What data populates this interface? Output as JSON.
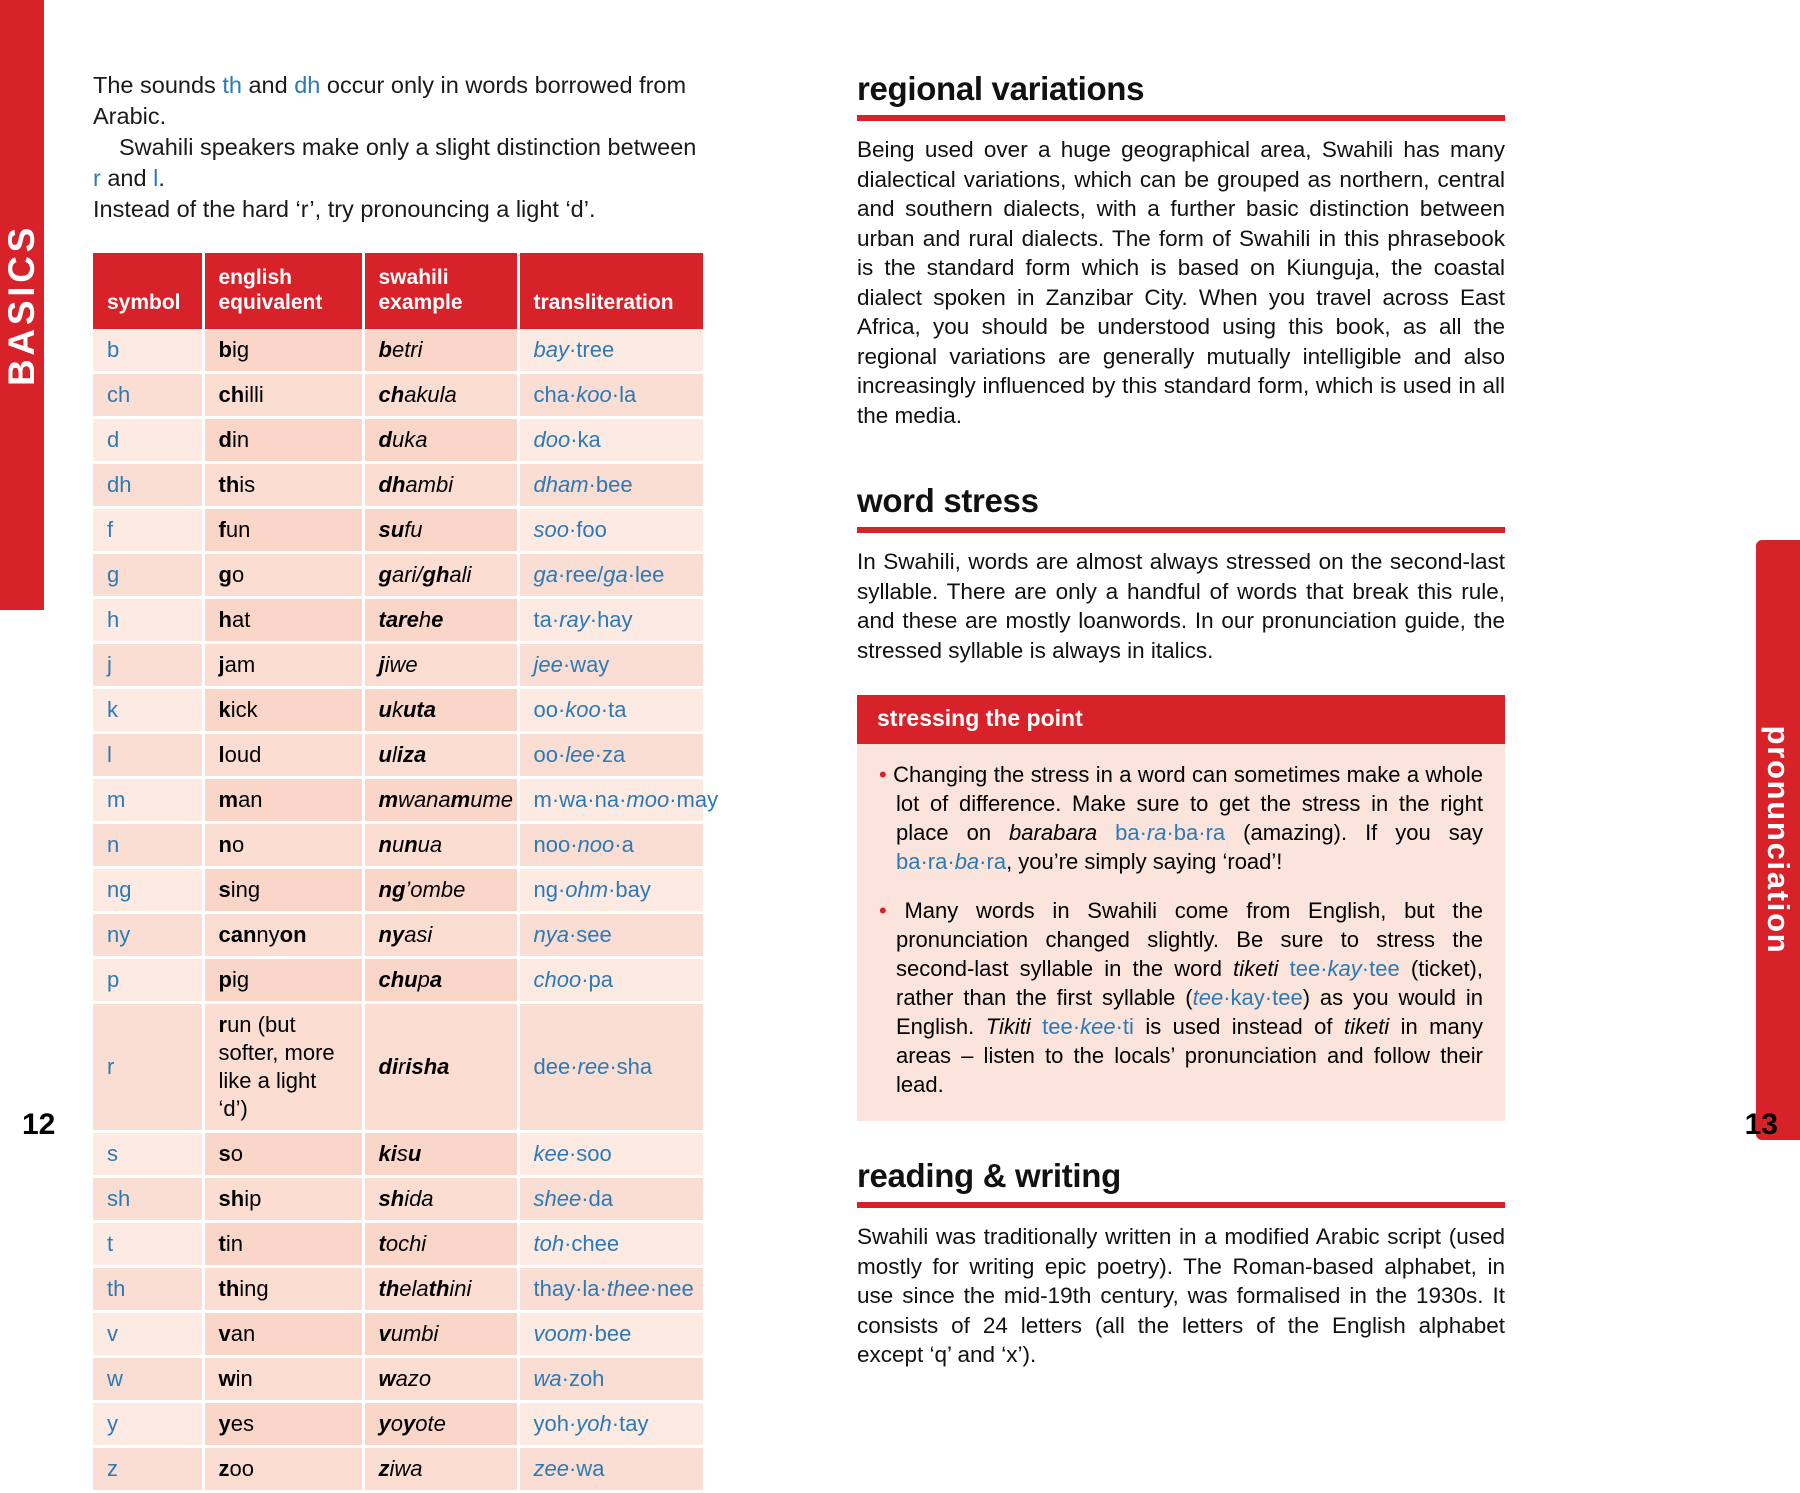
{
  "tabs": {
    "left_label": "BASICS",
    "right_label": "pronunciation"
  },
  "folios": {
    "left": "12",
    "right": "13"
  },
  "left_page": {
    "intro": {
      "line1_a": "The sounds ",
      "line1_b": "th",
      "line1_c": " and ",
      "line1_d": "dh",
      "line1_e": " occur only in words borrowed from Arabic.",
      "line2_a": "Swahili speakers make only a slight distinction between ",
      "line2_b": "r",
      "line2_c": " and ",
      "line2_d": "l",
      "line2_e": ".",
      "line3": "Instead of the hard ‘r’, try pronouncing a light ‘d’."
    },
    "table": {
      "headers": [
        "symbol",
        "english equivalent",
        "swahili example",
        "transliteration"
      ],
      "rows": [
        {
          "symbol": "b",
          "english": [
            "b",
            "ig"
          ],
          "swahili": [
            "b",
            "etri"
          ],
          "translit": "bay·tree",
          "tr_parts": [
            [
              "i",
              "bay"
            ],
            [
              "p",
              "·tree"
            ]
          ]
        },
        {
          "symbol": "ch",
          "english": [
            "ch",
            "illi"
          ],
          "swahili": [
            "ch",
            "akula"
          ],
          "translit": "cha·koo·la",
          "tr_parts": [
            [
              "p",
              "cha·"
            ],
            [
              "i",
              "koo"
            ],
            [
              "p",
              "·la"
            ]
          ]
        },
        {
          "symbol": "d",
          "english": [
            "d",
            "in"
          ],
          "swahili": [
            "d",
            "uka"
          ],
          "translit": "doo·ka",
          "tr_parts": [
            [
              "i",
              "doo"
            ],
            [
              "p",
              "·ka"
            ]
          ]
        },
        {
          "symbol": "dh",
          "english": [
            "th",
            "is"
          ],
          "swahili": [
            "dh",
            "ambi"
          ],
          "translit": "dham·bee",
          "tr_parts": [
            [
              "i",
              "dham"
            ],
            [
              "p",
              "·bee"
            ]
          ]
        },
        {
          "symbol": "f",
          "english": [
            "f",
            "un"
          ],
          "swahili": [
            "su",
            "fu"
          ],
          "translit": "soo·foo",
          "tr_parts": [
            [
              "i",
              "soo"
            ],
            [
              "p",
              "·foo"
            ]
          ]
        },
        {
          "symbol": "g",
          "english": [
            "g",
            "o"
          ],
          "swahili": [
            "g",
            "ari/",
            "gh",
            "ali"
          ],
          "translit": "ga·ree/ga·lee",
          "tr_parts": [
            [
              "i",
              "ga"
            ],
            [
              "p",
              "·ree/"
            ],
            [
              "i",
              "ga"
            ],
            [
              "p",
              "·lee"
            ]
          ]
        },
        {
          "symbol": "h",
          "english": [
            "h",
            "at"
          ],
          "swahili": [
            "tare",
            "h",
            "e"
          ],
          "translit": "ta·ray·hay",
          "tr_parts": [
            [
              "p",
              "ta·"
            ],
            [
              "i",
              "ray"
            ],
            [
              "p",
              "·hay"
            ]
          ]
        },
        {
          "symbol": "j",
          "english": [
            "j",
            "am"
          ],
          "swahili": [
            "j",
            "iwe"
          ],
          "translit": "jee·way",
          "tr_parts": [
            [
              "i",
              "jee"
            ],
            [
              "p",
              "·way"
            ]
          ]
        },
        {
          "symbol": "k",
          "english": [
            "k",
            "ick"
          ],
          "swahili": [
            "u",
            "k",
            "uta"
          ],
          "translit": "oo·koo·ta",
          "tr_parts": [
            [
              "p",
              "oo·"
            ],
            [
              "i",
              "koo"
            ],
            [
              "p",
              "·ta"
            ]
          ]
        },
        {
          "symbol": "l",
          "english": [
            "l",
            "oud"
          ],
          "swahili": [
            "u",
            "l",
            "iza"
          ],
          "translit": "oo·lee·za",
          "tr_parts": [
            [
              "p",
              "oo·"
            ],
            [
              "i",
              "lee"
            ],
            [
              "p",
              "·za"
            ]
          ]
        },
        {
          "symbol": "m",
          "english": [
            "m",
            "an"
          ],
          "swahili": [
            "m",
            "wana",
            "m",
            "ume"
          ],
          "translit": "m·wa·na·moo·may",
          "tr_parts": [
            [
              "p",
              "m·wa·na·"
            ],
            [
              "i",
              "moo"
            ],
            [
              "p",
              "·may"
            ]
          ]
        },
        {
          "symbol": "n",
          "english": [
            "n",
            "o"
          ],
          "swahili": [
            "n",
            "u",
            "n",
            "ua"
          ],
          "translit": "noo·noo·a",
          "tr_parts": [
            [
              "p",
              "noo·"
            ],
            [
              "i",
              "noo"
            ],
            [
              "p",
              "·a"
            ]
          ]
        },
        {
          "symbol": "ng",
          "english": [
            "s",
            "ing",
            ""
          ],
          "swahili": [
            "ng",
            "’ombe"
          ],
          "translit": "ng·ohm·bay",
          "tr_parts": [
            [
              "p",
              "ng·"
            ],
            [
              "i",
              "ohm"
            ],
            [
              "p",
              "·bay"
            ]
          ]
        },
        {
          "symbol": "ny",
          "english": [
            "can",
            "ny",
            "on"
          ],
          "swahili": [
            "ny",
            "asi"
          ],
          "translit": "nya·see",
          "tr_parts": [
            [
              "i",
              "nya"
            ],
            [
              "p",
              "·see"
            ]
          ]
        },
        {
          "symbol": "p",
          "english": [
            "p",
            "ig"
          ],
          "swahili": [
            "chu",
            "p",
            "a"
          ],
          "translit": "choo·pa",
          "tr_parts": [
            [
              "i",
              "choo"
            ],
            [
              "p",
              "·pa"
            ]
          ]
        },
        {
          "symbol": "r",
          "english": [
            "r",
            "un (but softer, more like a light ‘d’)"
          ],
          "swahili": [
            "di",
            "r",
            "isha"
          ],
          "translit": "dee·ree·sha",
          "tr_parts": [
            [
              "p",
              "dee·"
            ],
            [
              "i",
              "ree"
            ],
            [
              "p",
              "·sha"
            ]
          ],
          "tall": true
        },
        {
          "symbol": "s",
          "english": [
            "s",
            "o"
          ],
          "swahili": [
            "ki",
            "s",
            "u"
          ],
          "translit": "kee·soo",
          "tr_parts": [
            [
              "i",
              "kee"
            ],
            [
              "p",
              "·soo"
            ]
          ]
        },
        {
          "symbol": "sh",
          "english": [
            "sh",
            "ip"
          ],
          "swahili": [
            "sh",
            "ida"
          ],
          "translit": "shee·da",
          "tr_parts": [
            [
              "i",
              "shee"
            ],
            [
              "p",
              "·da"
            ]
          ]
        },
        {
          "symbol": "t",
          "english": [
            "t",
            "in"
          ],
          "swahili": [
            "t",
            "ochi"
          ],
          "translit": "toh·chee",
          "tr_parts": [
            [
              "i",
              "toh"
            ],
            [
              "p",
              "·chee"
            ]
          ]
        },
        {
          "symbol": "th",
          "english": [
            "th",
            "ing"
          ],
          "swahili": [
            "th",
            "ela",
            "th",
            "ini"
          ],
          "translit": "thay·la·thee·nee",
          "tr_parts": [
            [
              "p",
              "thay·la·"
            ],
            [
              "i",
              "thee"
            ],
            [
              "p",
              "·nee"
            ]
          ]
        },
        {
          "symbol": "v",
          "english": [
            "v",
            "an"
          ],
          "swahili": [
            "v",
            "umbi"
          ],
          "translit": "voom·bee",
          "tr_parts": [
            [
              "i",
              "voom"
            ],
            [
              "p",
              "·bee"
            ]
          ]
        },
        {
          "symbol": "w",
          "english": [
            "w",
            "in"
          ],
          "swahili": [
            "w",
            "azo"
          ],
          "translit": "wa·zoh",
          "tr_parts": [
            [
              "i",
              "wa"
            ],
            [
              "p",
              "·zoh"
            ]
          ]
        },
        {
          "symbol": "y",
          "english": [
            "y",
            "es"
          ],
          "swahili": [
            "y",
            "o",
            "y",
            "ote"
          ],
          "translit": "yoh·yoh·tay",
          "tr_parts": [
            [
              "p",
              "yoh·"
            ],
            [
              "i",
              "yoh"
            ],
            [
              "p",
              "·tay"
            ]
          ]
        },
        {
          "symbol": "z",
          "english": [
            "z",
            "oo"
          ],
          "swahili": [
            "z",
            "iwa"
          ],
          "translit": "zee·wa",
          "tr_parts": [
            [
              "i",
              "zee"
            ],
            [
              "p",
              "·wa"
            ]
          ]
        }
      ]
    }
  },
  "right_page": {
    "sections": [
      {
        "title": "regional variations",
        "body": "Being used over a huge geographical area, Swahili has many dialectical variations, which can be grouped as northern, central and southern dialects, with a further basic distinction between urban and rural dialects. The form of Swahili in this phrasebook is the standard form which is based on Kiunguja, the coastal dialect spoken in Zanzibar City. When you travel across East Africa, you should be understood using this book, as all the regional variations are generally mutually intelligible and also increasingly influenced by this standard form, which is used in all the media."
      },
      {
        "title": "word stress",
        "body": "In Swahili, words are almost always stressed on the second-last syllable. There are only a handful of words that break this rule, and these are mostly loanwords. In our pronunciation guide, the stressed syllable is always in italics."
      },
      {
        "title": "reading & writing",
        "body": "Swahili was traditionally written in a modified Arabic script (used mostly for writing epic poetry). The Roman-based alphabet, in use since the mid-19th century, was formalised in the 1930s. It consists of 24 letters (all the letters of the English alphabet except ‘q’ and ‘x’)."
      }
    ],
    "tipbox": {
      "title": "stressing the point",
      "bullets": [
        {
          "t1": "Changing the stress in a word can sometimes make a whole lot of difference. Make sure to get the stress in the right place on ",
          "w1_it": "barabara",
          "t2": " ",
          "b1_p1": "ba·",
          "b1_i1": "ra",
          "b1_p2": "·ba·ra",
          "t3": " (amazing). If you say ",
          "b2_p1": "ba·ra·",
          "b2_i1": "ba",
          "b2_p2": "·ra",
          "t4": ", you’re simply saying ‘road’!"
        },
        {
          "t1": "Many words in Swahili come from English, but the pronunciation changed slightly. Be sure to stress the second-last syllable in the word ",
          "w1_it": "tiketi",
          "t2": " ",
          "b1_p1": "tee·",
          "b1_i1": "kay",
          "b1_p2": "·tee",
          "t3": " (ticket), rather than the first syllable (",
          "b2_i1": "tee",
          "b2_p1": "·kay·tee",
          "t4": ") as you would in English. ",
          "w2_it": "Tikiti",
          "t5": " ",
          "b3_p1": "tee·",
          "b3_i1": "kee",
          "b3_p2": "·ti",
          "t6": " is used instead of ",
          "w3_it": "tiketi",
          "t7": " in many areas – listen to the locals’ pronunciation and follow their lead."
        }
      ]
    }
  },
  "colors": {
    "brand_red": "#d8222a",
    "translit_blue": "#2b7ab5",
    "row_pink_light": "#fdeae3",
    "row_pink_dark": "#f9d6c8"
  }
}
